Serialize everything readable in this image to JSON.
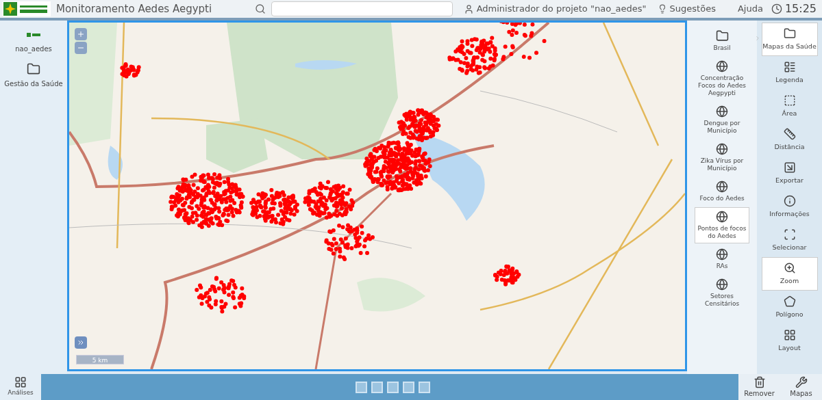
{
  "header": {
    "title": "Monitoramento Aedes Aegypti",
    "user": "Administrador do projeto \"nao_aedes\"",
    "suggestions": "Sugestões",
    "help": "Ajuda",
    "time": "15:25"
  },
  "left_sidebar": {
    "items": [
      {
        "kind": "project",
        "label": "nao_aedes"
      },
      {
        "kind": "folder",
        "label": "Gestão da Saúde"
      }
    ]
  },
  "map": {
    "scale": "5 km"
  },
  "layers": [
    {
      "kind": "folder",
      "label": "Brasil",
      "selected": false
    },
    {
      "kind": "layer",
      "label": "Concentração Focos do Aedes Aegpypti",
      "selected": false
    },
    {
      "kind": "layer",
      "label": "Dengue por Município",
      "selected": false
    },
    {
      "kind": "layer",
      "label": "Zika Vírus por Município",
      "selected": false
    },
    {
      "kind": "layer",
      "label": "Foco do Aedes",
      "selected": false
    },
    {
      "kind": "layer",
      "label": "Pontos de focos do Aedes",
      "selected": true
    },
    {
      "kind": "layer",
      "label": "RAs",
      "selected": false
    },
    {
      "kind": "layer",
      "label": "Setores Censitários",
      "selected": false
    }
  ],
  "tools": [
    {
      "label": "Mapas da Saúde",
      "selected": true
    },
    {
      "label": "Legenda",
      "selected": false
    },
    {
      "label": "Área",
      "selected": false
    },
    {
      "label": "Distância",
      "selected": false
    },
    {
      "label": "Exportar",
      "selected": false
    },
    {
      "label": "Informações",
      "selected": false
    },
    {
      "label": "Selecionar",
      "selected": false
    },
    {
      "label": "Zoom",
      "selected": true
    },
    {
      "label": "Polígono",
      "selected": false
    },
    {
      "label": "Layout",
      "selected": false
    }
  ],
  "bottom_bar": {
    "left": "Análises",
    "right": [
      "Remover",
      "Mapas"
    ]
  }
}
